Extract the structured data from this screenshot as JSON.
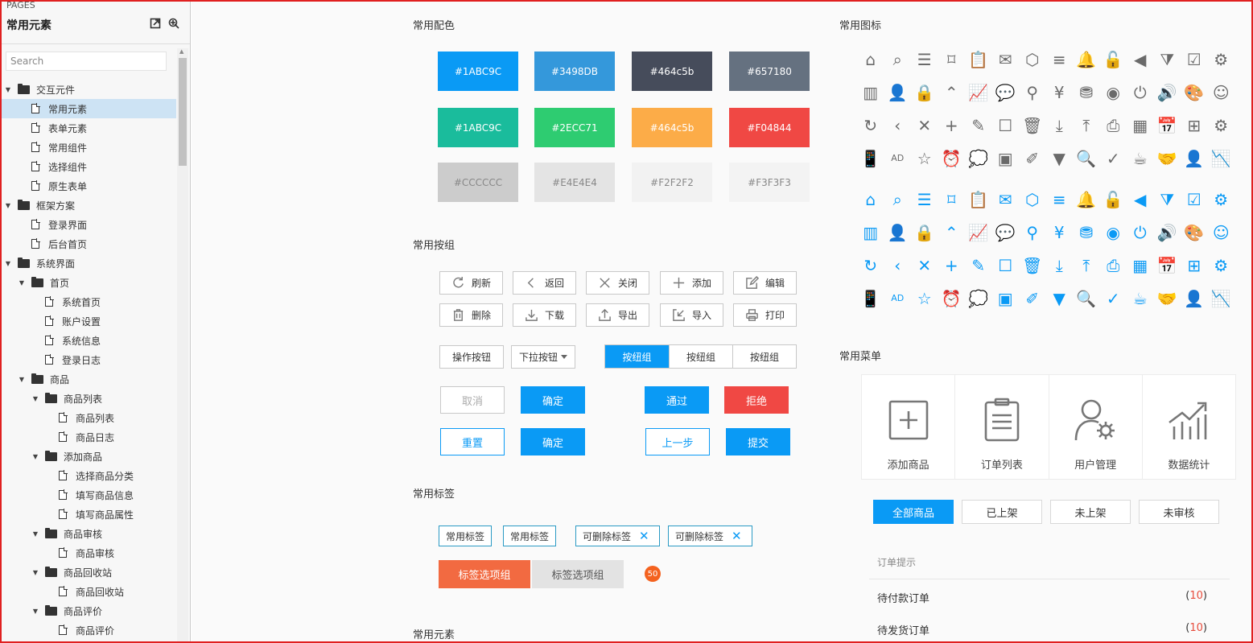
{
  "sidebar": {
    "pages_label": "PAGES",
    "title": "常用元素",
    "search_placeholder": "Search",
    "tree": [
      {
        "label": "交互元件",
        "type": "folder",
        "depth": 0
      },
      {
        "label": "常用元素",
        "type": "file",
        "depth": 1,
        "selected": true
      },
      {
        "label": "表单元素",
        "type": "file",
        "depth": 1
      },
      {
        "label": "常用组件",
        "type": "file",
        "depth": 1
      },
      {
        "label": "选择组件",
        "type": "file",
        "depth": 1
      },
      {
        "label": "原生表单",
        "type": "file",
        "depth": 1
      },
      {
        "label": "框架方案",
        "type": "folder",
        "depth": 0
      },
      {
        "label": "登录界面",
        "type": "file",
        "depth": 1
      },
      {
        "label": "后台首页",
        "type": "file",
        "depth": 1
      },
      {
        "label": "系统界面",
        "type": "folder",
        "depth": 0
      },
      {
        "label": "首页",
        "type": "folder",
        "depth": 1
      },
      {
        "label": "系统首页",
        "type": "file",
        "depth": 2
      },
      {
        "label": "账户设置",
        "type": "file",
        "depth": 2
      },
      {
        "label": "系统信息",
        "type": "file",
        "depth": 2
      },
      {
        "label": "登录日志",
        "type": "file",
        "depth": 2
      },
      {
        "label": "商品",
        "type": "folder",
        "depth": 1
      },
      {
        "label": "商品列表",
        "type": "folder",
        "depth": 2
      },
      {
        "label": "商品列表",
        "type": "file",
        "depth": 3
      },
      {
        "label": "商品日志",
        "type": "file",
        "depth": 3
      },
      {
        "label": "添加商品",
        "type": "folder",
        "depth": 2
      },
      {
        "label": "选择商品分类",
        "type": "file",
        "depth": 3
      },
      {
        "label": "填写商品信息",
        "type": "file",
        "depth": 3
      },
      {
        "label": "填写商品属性",
        "type": "file",
        "depth": 3
      },
      {
        "label": "商品审核",
        "type": "folder",
        "depth": 2
      },
      {
        "label": "商品审核",
        "type": "file",
        "depth": 3
      },
      {
        "label": "商品回收站",
        "type": "folder",
        "depth": 2
      },
      {
        "label": "商品回收站",
        "type": "file",
        "depth": 3
      },
      {
        "label": "商品评价",
        "type": "folder",
        "depth": 2
      },
      {
        "label": "商品评价",
        "type": "file",
        "depth": 3
      }
    ]
  },
  "colors": {
    "title": "常用配色",
    "swatches": [
      {
        "label": "#1ABC9C",
        "color": "#0a9af5"
      },
      {
        "label": "#3498DB",
        "color": "#3498db"
      },
      {
        "label": "#464c5b",
        "color": "#464c5b"
      },
      {
        "label": "#657180",
        "color": "#657180"
      },
      {
        "label": "#1ABC9C",
        "color": "#1abc9c"
      },
      {
        "label": "#2ECC71",
        "color": "#2ecc71"
      },
      {
        "label": "#464c5b",
        "color": "#fcac48"
      },
      {
        "label": "#F04844",
        "color": "#f04844"
      },
      {
        "label": "#CCCCCC",
        "color": "#cccccc"
      },
      {
        "label": "#E4E4E4",
        "color": "#e4e4e4"
      },
      {
        "label": "#F2F2F2",
        "color": "#f2f2f2"
      },
      {
        "label": "#F3F3F3",
        "color": "#f3f3f3"
      }
    ]
  },
  "buttons": {
    "title": "常用按组",
    "icon_buttons": [
      {
        "label": "刷新",
        "icon": "refresh-icon"
      },
      {
        "label": "返回",
        "icon": "chevron-left-icon"
      },
      {
        "label": "关闭",
        "icon": "close-icon"
      },
      {
        "label": "添加",
        "icon": "plus-icon"
      },
      {
        "label": "编辑",
        "icon": "edit-icon"
      },
      {
        "label": "删除",
        "icon": "trash-icon"
      },
      {
        "label": "下载",
        "icon": "download-icon"
      },
      {
        "label": "导出",
        "icon": "export-icon"
      },
      {
        "label": "导入",
        "icon": "import-icon"
      },
      {
        "label": "打印",
        "icon": "printer-icon"
      }
    ],
    "action_button": "操作按钮",
    "dropdown_button": "下拉按钮",
    "segmented": [
      "按纽组",
      "按纽组",
      "按纽组"
    ],
    "cancel": "取消",
    "confirm1": "确定",
    "pass": "通过",
    "reject": "拒绝",
    "reset": "重置",
    "confirm2": "确定",
    "prev": "上一步",
    "submit": "提交"
  },
  "tags": {
    "title": "常用标签",
    "plain": [
      "常用标签",
      "常用标签"
    ],
    "removable": [
      "可删除标签",
      "可删除标签"
    ],
    "tab_on": "标签选项组",
    "tab_off": "标签选项组",
    "badge": "50"
  },
  "elements_title": "常用元素",
  "icons": {
    "title": "常用图标",
    "glyphs": [
      "⌂",
      "⌕",
      "☰",
      "⌑",
      "📋",
      "✉",
      "⬡",
      "≡",
      "🔔",
      "🔓",
      "◀",
      "⧩",
      "☑",
      "⚙",
      "▥",
      "👤",
      "🔒",
      "⌃",
      "📈",
      "💬",
      "⚲",
      "¥",
      "⛃",
      "◉",
      "⏻",
      "🔊",
      "🎨",
      "☺",
      "↻",
      "‹",
      "✕",
      "+",
      "✎",
      "☐",
      "🗑",
      "⤓",
      "⤒",
      "⎙",
      "▦",
      "📅",
      "⊞",
      "⚙",
      "📱",
      "AD",
      "☆",
      "⏰",
      "💭",
      "▣",
      "✐",
      "▼",
      "🔍",
      "✓",
      "☕",
      "🤝",
      "👤",
      "📉"
    ]
  },
  "menus": {
    "title": "常用菜单",
    "items": [
      {
        "label": "添加商品",
        "icon": "add-box-icon"
      },
      {
        "label": "订单列表",
        "icon": "clipboard-list-icon"
      },
      {
        "label": "用户管理",
        "icon": "user-gear-icon"
      },
      {
        "label": "数据统计",
        "icon": "bar-chart-icon"
      }
    ],
    "filter_tabs": [
      "全部商品",
      "已上架",
      "未上架",
      "未审核"
    ]
  },
  "orders": {
    "title": "订单提示",
    "rows": [
      {
        "label": "待付款订单",
        "count": "10"
      },
      {
        "label": "待发货订单",
        "count": "10"
      }
    ]
  }
}
